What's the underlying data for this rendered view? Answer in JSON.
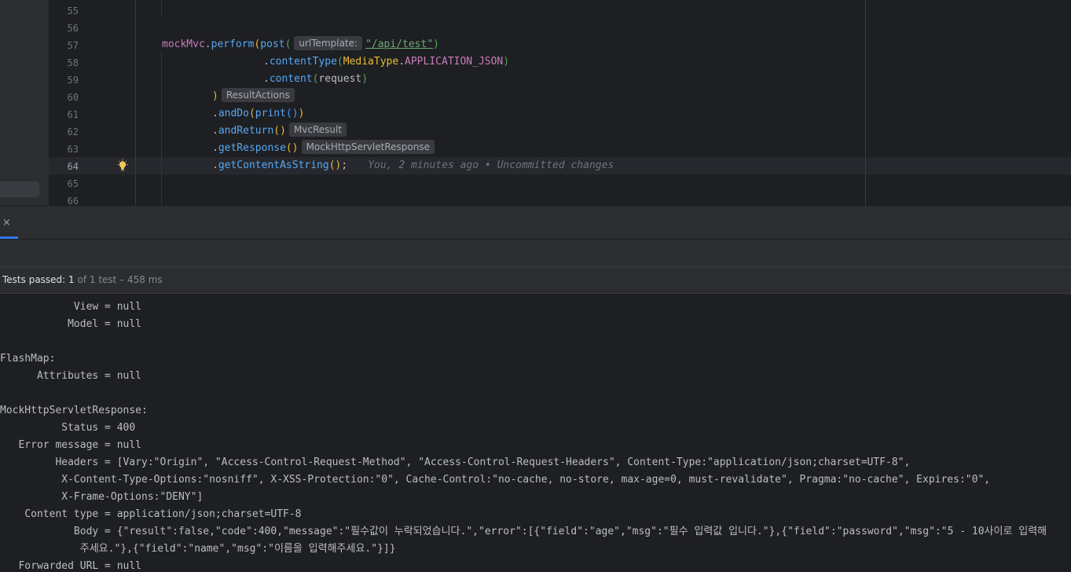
{
  "editor": {
    "line_numbers": [
      "55",
      "56",
      "57",
      "58",
      "59",
      "60",
      "61",
      "62",
      "63",
      "64",
      "65",
      "66"
    ],
    "active_line": "64",
    "line57": {
      "field": "mockMvc",
      "dot1": ".",
      "method": "perform",
      "open1": "(",
      "call": "post",
      "open2": "(",
      "hint": "urlTemplate:",
      "string": "\"/api/test\"",
      "close2": ")"
    },
    "line58": {
      "dot": ".",
      "method": "contentType",
      "open": "(",
      "cls": "MediaType",
      "dot2": ".",
      "const": "APPLICATION_JSON",
      "close": ")"
    },
    "line59": {
      "dot": ".",
      "method": "content",
      "open": "(",
      "arg": "request",
      "close": ")"
    },
    "line60": {
      "close": ")",
      "hint": "ResultActions"
    },
    "line61": {
      "dot": ".",
      "method": "andDo",
      "open": "(",
      "call": "print",
      "inner": "()",
      "close": ")"
    },
    "line62": {
      "dot": ".",
      "method": "andReturn",
      "parens": "()",
      "hint": "MvcResult"
    },
    "line63": {
      "dot": ".",
      "method": "getResponse",
      "parens": "()",
      "hint": "MockHttpServletResponse"
    },
    "line64": {
      "dot": ".",
      "method": "getContentAsString",
      "parens": "()",
      "semi": ";",
      "blame": "You, 2 minutes ago • Uncommitted changes"
    }
  },
  "tool_window": {
    "close_glyph": "×",
    "status": {
      "label": "Tests passed: ",
      "passed": "1",
      "rest": " of 1 test – 458 ms"
    },
    "console_lines": [
      "            View = null",
      "           Model = null",
      "",
      "FlashMap:",
      "      Attributes = null",
      "",
      "MockHttpServletResponse:",
      "          Status = 400",
      "   Error message = null",
      "         Headers = [Vary:\"Origin\", \"Access-Control-Request-Method\", \"Access-Control-Request-Headers\", Content-Type:\"application/json;charset=UTF-8\",",
      "          X-Content-Type-Options:\"nosniff\", X-XSS-Protection:\"0\", Cache-Control:\"no-cache, no-store, max-age=0, must-revalidate\", Pragma:\"no-cache\", Expires:\"0\",",
      "          X-Frame-Options:\"DENY\"]",
      "    Content type = application/json;charset=UTF-8",
      "            Body = {\"result\":false,\"code\":400,\"message\":\"필수값이 누락되었습니다.\",\"error\":[{\"field\":\"age\",\"msg\":\"필수 입력값 입니다.\"},{\"field\":\"password\",\"msg\":\"5 - 10사이로 입력해",
      "             주세요.\"},{\"field\":\"name\",\"msg\":\"이름을 입력해주세요.\"}]}",
      "   Forwarded URL = null"
    ]
  },
  "colors": {
    "field": "#c77dbb",
    "method": "#56a8f5",
    "string": "#6aab73",
    "paren_gold": "#e8ba36",
    "paren_green": "#54a857",
    "accent": "#3574f0"
  }
}
